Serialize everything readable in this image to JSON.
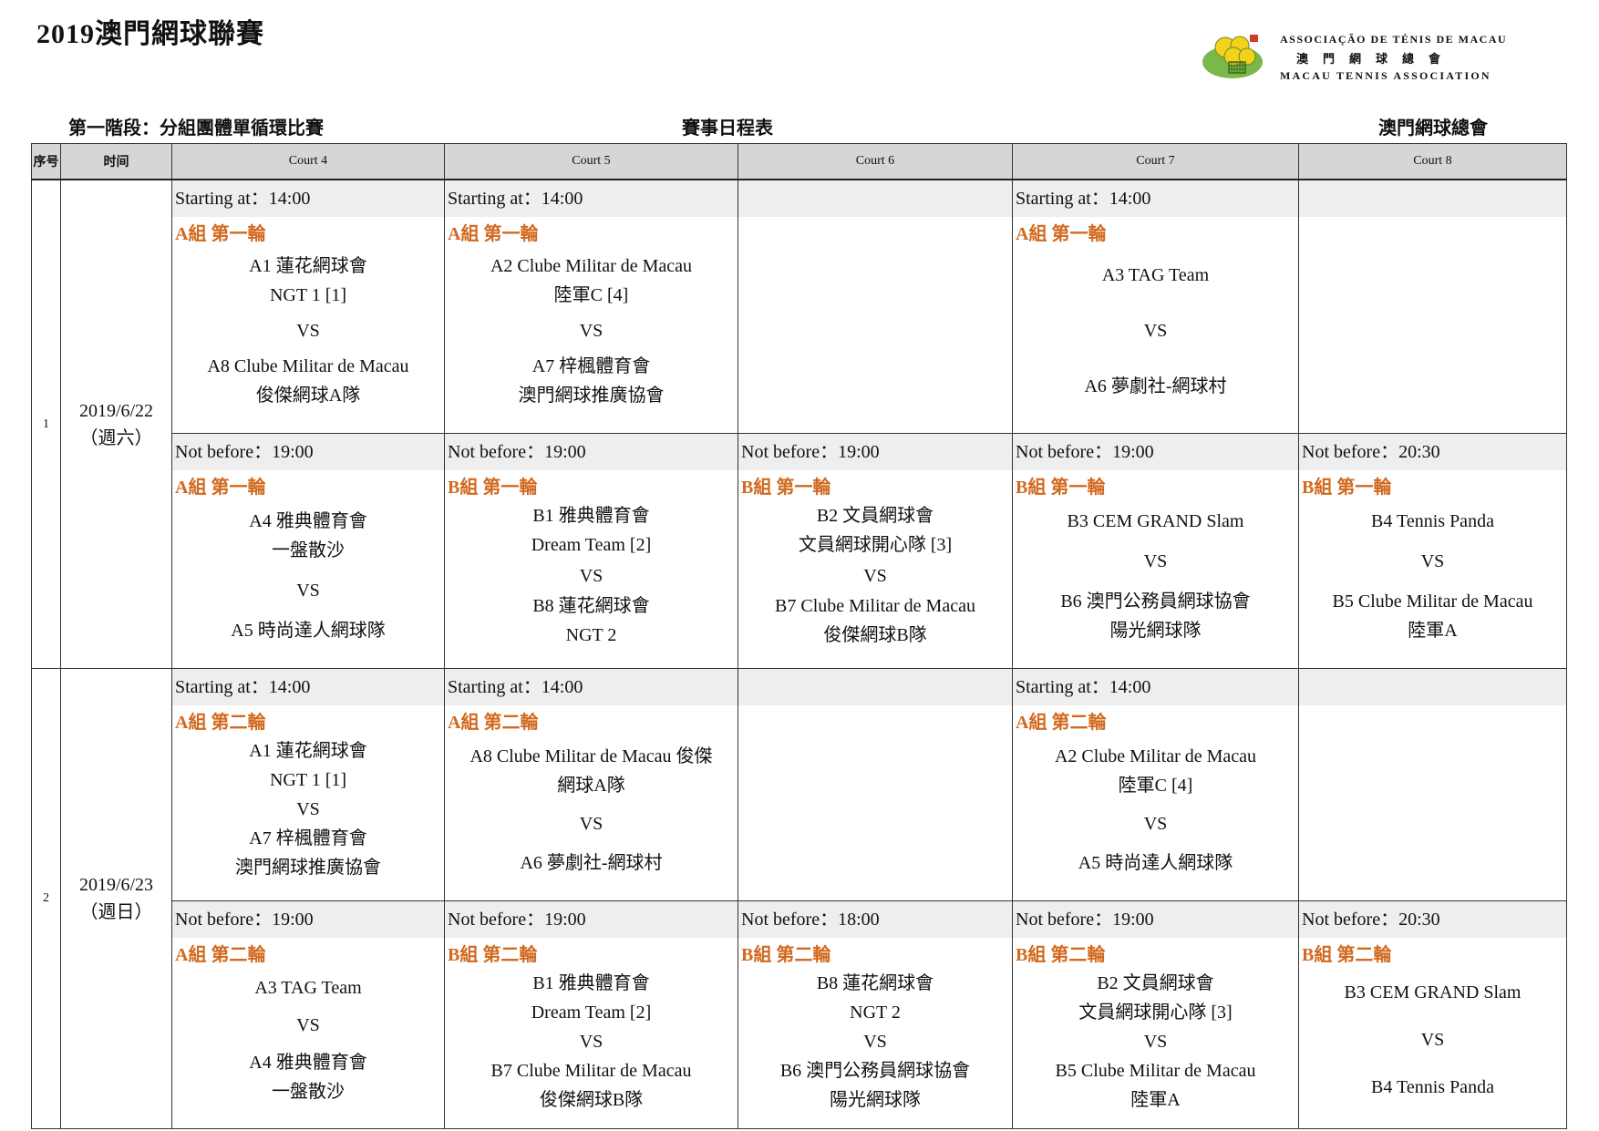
{
  "doc": {
    "title": "2019澳門網球聯賽",
    "stage": "第一階段：分組團體單循環比賽",
    "schedule_title": "賽事日程表",
    "organizer": "澳門網球總會"
  },
  "logo": {
    "line1": "ASSOCIAÇÃO DE TÉNIS DE MACAU",
    "line2": "澳門網球總會",
    "line3": "MACAU TENNIS ASSOCIATION"
  },
  "table": {
    "headers": [
      "序号",
      "时间",
      "Court 4",
      "Court 5",
      "Court 6",
      "Court 7",
      "Court 8"
    ],
    "vs": "VS",
    "days": [
      {
        "index": "1",
        "date": "2019/6/22",
        "weekday": "（週六）",
        "slots": [
          {
            "courts": [
              {
                "time": "Starting at：14:00",
                "group": "A組 第一輪",
                "home": [
                  "A1 蓮花網球會",
                  "NGT 1 [1]"
                ],
                "away": [
                  "A8 Clube Militar de Macau",
                  "俊傑網球A隊"
                ]
              },
              {
                "time": "Starting at：14:00",
                "group": "A組 第一輪",
                "home": [
                  "A2 Clube Militar de Macau",
                  "陸軍C [4]"
                ],
                "away": [
                  "A7 梓楓體育會",
                  "澳門網球推廣協會"
                ]
              },
              {
                "time": "",
                "group": "",
                "home": [],
                "away": []
              },
              {
                "time": "Starting at：14:00",
                "group": "A組 第一輪",
                "home": [
                  "A3 TAG Team"
                ],
                "away": [
                  "A6 夢劇社-網球村"
                ]
              },
              {
                "time": "",
                "group": "",
                "home": [],
                "away": []
              }
            ]
          },
          {
            "courts": [
              {
                "time": "Not before：19:00",
                "group": "A組 第一輪",
                "home": [
                  "A4 雅典體育會",
                  "一盤散沙"
                ],
                "away": [
                  "A5 時尚達人網球隊"
                ]
              },
              {
                "time": "Not before：19:00",
                "group": "B組 第一輪",
                "home": [
                  "B1 雅典體育會",
                  "Dream Team [2]"
                ],
                "away": [
                  "B8 蓮花網球會",
                  "NGT 2"
                ]
              },
              {
                "time": "Not before：19:00",
                "group": "B組 第一輪",
                "home": [
                  "B2 文員網球會",
                  "文員網球開心隊 [3]"
                ],
                "away": [
                  "B7 Clube Militar de Macau",
                  "俊傑網球B隊"
                ]
              },
              {
                "time": "Not before：19:00",
                "group": "B組 第一輪",
                "home": [
                  "B3 CEM GRAND Slam"
                ],
                "away": [
                  "B6 澳門公務員網球協會",
                  "陽光網球隊"
                ]
              },
              {
                "time": "Not before：20:30",
                "group": "B組 第一輪",
                "home": [
                  "B4 Tennis Panda"
                ],
                "away": [
                  "B5 Clube Militar de Macau",
                  "陸軍A"
                ]
              }
            ]
          }
        ]
      },
      {
        "index": "2",
        "date": "2019/6/23",
        "weekday": "（週日）",
        "slots": [
          {
            "courts": [
              {
                "time": "Starting at：14:00",
                "group": "A組 第二輪",
                "home": [
                  "A1 蓮花網球會",
                  "NGT 1 [1]"
                ],
                "away": [
                  "A7 梓楓體育會",
                  "澳門網球推廣協會"
                ]
              },
              {
                "time": "Starting at：14:00",
                "group": "A組 第二輪",
                "home": [
                  "A8 Clube Militar de Macau 俊傑",
                  "網球A隊"
                ],
                "away": [
                  "A6 夢劇社-網球村"
                ]
              },
              {
                "time": "",
                "group": "",
                "home": [],
                "away": []
              },
              {
                "time": "Starting at：14:00",
                "group": "A組 第二輪",
                "home": [
                  "A2 Clube Militar de Macau",
                  "陸軍C [4]"
                ],
                "away": [
                  "A5 時尚達人網球隊"
                ]
              },
              {
                "time": "",
                "group": "",
                "home": [],
                "away": []
              }
            ]
          },
          {
            "courts": [
              {
                "time": "Not before：19:00",
                "group": "A組 第二輪",
                "home": [
                  "A3 TAG Team"
                ],
                "away": [
                  "A4 雅典體育會",
                  "一盤散沙"
                ]
              },
              {
                "time": "Not before：19:00",
                "group": "B組 第二輪",
                "home": [
                  "B1 雅典體育會",
                  "Dream Team [2]"
                ],
                "away": [
                  "B7 Clube Militar de Macau",
                  "俊傑網球B隊"
                ]
              },
              {
                "time": "Not before：18:00",
                "group": "B組 第二輪",
                "home": [
                  "B8 蓮花網球會",
                  "NGT 2"
                ],
                "away": [
                  "B6 澳門公務員網球協會",
                  "陽光網球隊"
                ]
              },
              {
                "time": "Not before：19:00",
                "group": "B組 第二輪",
                "home": [
                  "B2 文員網球會",
                  "文員網球開心隊 [3]"
                ],
                "away": [
                  "B5 Clube Militar de Macau",
                  "陸軍A"
                ]
              },
              {
                "time": "Not before：20:30",
                "group": "B組 第二輪",
                "home": [
                  "B3 CEM GRAND Slam"
                ],
                "away": [
                  "B4 Tennis Panda"
                ]
              }
            ]
          }
        ]
      }
    ]
  },
  "colors": {
    "group_label": "#d2691e",
    "header_bg": "#d6d6d6",
    "time_band_bg": "#eeeeee",
    "logo_green": "#7ab84a",
    "logo_yellow": "#f2d21b"
  }
}
